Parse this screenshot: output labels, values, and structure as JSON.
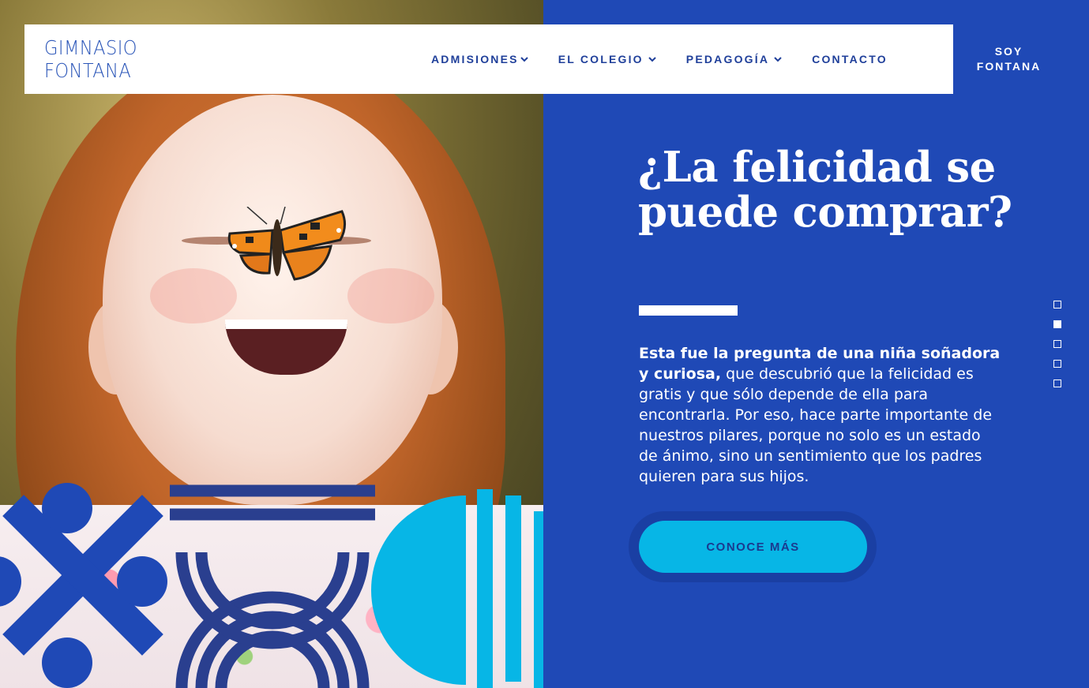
{
  "brand": {
    "line1": "GIMNASIO",
    "line2": "FONTANA"
  },
  "nav": {
    "items": [
      {
        "label": "ADMISIONES",
        "has_dropdown": true
      },
      {
        "label": "EL COLEGIO",
        "has_dropdown": true
      },
      {
        "label": "PEDAGOGÍA",
        "has_dropdown": true
      },
      {
        "label": "CONTACTO",
        "has_dropdown": false
      }
    ],
    "cta": {
      "line1": "SOY",
      "line2": "FONTANA"
    }
  },
  "hero": {
    "title": "¿La felicidad se puede comprar?",
    "body_strong": "Esta fue la pregunta de una niña soñadora y curiosa,",
    "body_rest": " que descubrió que la felicidad es gratis y que sólo depende de ella para encontrarla. Por eso, hace parte importante de nuestros pilares, porque no solo es un estado de ánimo, sino un sentimiento que los padres quieren para sus hijos.",
    "button_label": "CONOCE MÁS"
  },
  "pager": {
    "count": 5,
    "active_index": 1
  },
  "colors": {
    "brand_blue": "#1f49b6",
    "accent_cyan": "#07b6e6",
    "nav_text": "#1f3f9a",
    "white": "#ffffff"
  },
  "icons": [
    "chevron-down-icon",
    "butterfly-image",
    "decorative-shapes"
  ]
}
